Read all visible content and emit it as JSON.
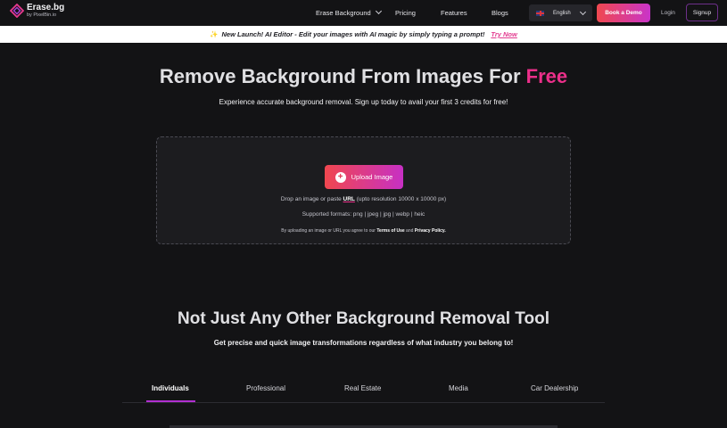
{
  "nav": {
    "logo_name": "Erase.bg",
    "logo_sub": "by PixelBin.io",
    "links": [
      "Erase Background",
      "Pricing",
      "Features",
      "Blogs"
    ],
    "language": "English",
    "demo_label": "Book a Demo",
    "login_label": "Login",
    "signup_label": "Signup"
  },
  "banner": {
    "text": "New Launch! AI Editor - Edit your images with AI magic by simply typing a prompt!",
    "link": "Try Now"
  },
  "hero": {
    "title_main": "Remove Background From Images For ",
    "title_accent": "Free",
    "subtitle": "Experience accurate background removal. Sign up today to avail your first 3 credits for free!"
  },
  "upload": {
    "button": "Upload Image",
    "drop_prefix": "Drop an image or paste ",
    "drop_url": "URL",
    "drop_suffix": " (upto resolution 10000 x 10000 px)",
    "formats": "Supported formats: png | jpeg | jpg | webp | heic",
    "terms_prefix": "By uploading an image or URL you agree to our ",
    "terms_link": "Terms of Use",
    "terms_mid": " and ",
    "privacy_link": "Privacy Policy."
  },
  "section": {
    "title": "Not Just Any Other Background Removal Tool",
    "subtitle": "Get precise and quick image transformations regardless of what industry you belong to!"
  },
  "tabs": [
    "Individuals",
    "Professional",
    "Real Estate",
    "Media",
    "Car Dealership"
  ],
  "colors": {
    "accent_pink": "#ec2f8a",
    "gradient_start": "#f0474f",
    "gradient_end": "#c730c4",
    "background": "#131315"
  }
}
